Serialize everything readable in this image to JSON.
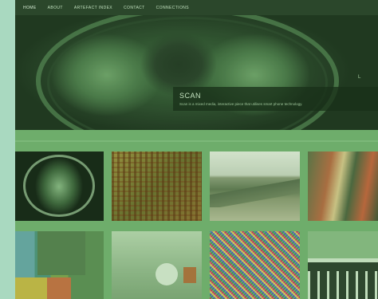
{
  "nav": {
    "items": [
      "HOME",
      "ABOUT",
      "ARTEFACT INDEX",
      "CONTACT",
      "CONNECTIONS"
    ]
  },
  "hero": {
    "side_label": "L",
    "caption": {
      "title": "SCAN",
      "text": "Scan is a mixed media, interactive piece that utilises smart phone technology."
    }
  },
  "gallery": {
    "items": [
      {
        "icon": "brain-scan-image"
      },
      {
        "icon": "abstract-texture-image"
      },
      {
        "icon": "landscape-image"
      },
      {
        "icon": "mural-image"
      },
      {
        "icon": "color-blocks-image"
      },
      {
        "icon": "installation-image"
      },
      {
        "icon": "pixel-noise-image"
      },
      {
        "icon": "fence-image"
      }
    ]
  },
  "colors": {
    "navbar": "#263a26",
    "page": "#72ad6f",
    "outer": "#a9d9c0"
  }
}
